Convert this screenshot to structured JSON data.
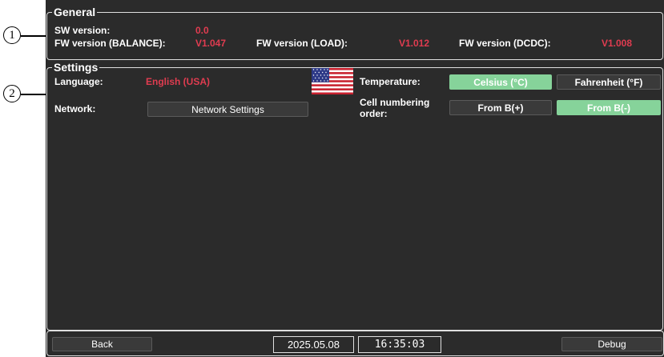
{
  "callouts": [
    "1",
    "2"
  ],
  "general": {
    "title": "General",
    "sw_label": "SW version:",
    "sw_value": "0.0",
    "fw_balance_label": "FW version (BALANCE):",
    "fw_balance_value": "V1.047",
    "fw_load_label": "FW version (LOAD):",
    "fw_load_value": "V1.012",
    "fw_dcdc_label": "FW version (DCDC):",
    "fw_dcdc_value": "V1.008"
  },
  "settings": {
    "title": "Settings",
    "language_label": "Language:",
    "language_value": "English (USA)",
    "flag_icon": "us-flag-icon",
    "network_label": "Network:",
    "network_button": "Network Settings",
    "temperature_label": "Temperature:",
    "temperature_options": [
      "Celsius (°C)",
      "Fahrenheit (°F)"
    ],
    "temperature_selected": "Celsius (°C)",
    "cell_order_label_line1": "Cell numbering",
    "cell_order_label_line2": "order:",
    "cell_order_options": [
      "From B(+)",
      "From B(-)"
    ],
    "cell_order_selected": "From B(-)"
  },
  "bottom": {
    "back_label": "Back",
    "date": "2025.05.08",
    "time": "16:35:03",
    "debug_label": "Debug"
  },
  "colors": {
    "background": "#2b2b2b",
    "value_red": "#e03c50",
    "active_green": "#86d39a"
  }
}
